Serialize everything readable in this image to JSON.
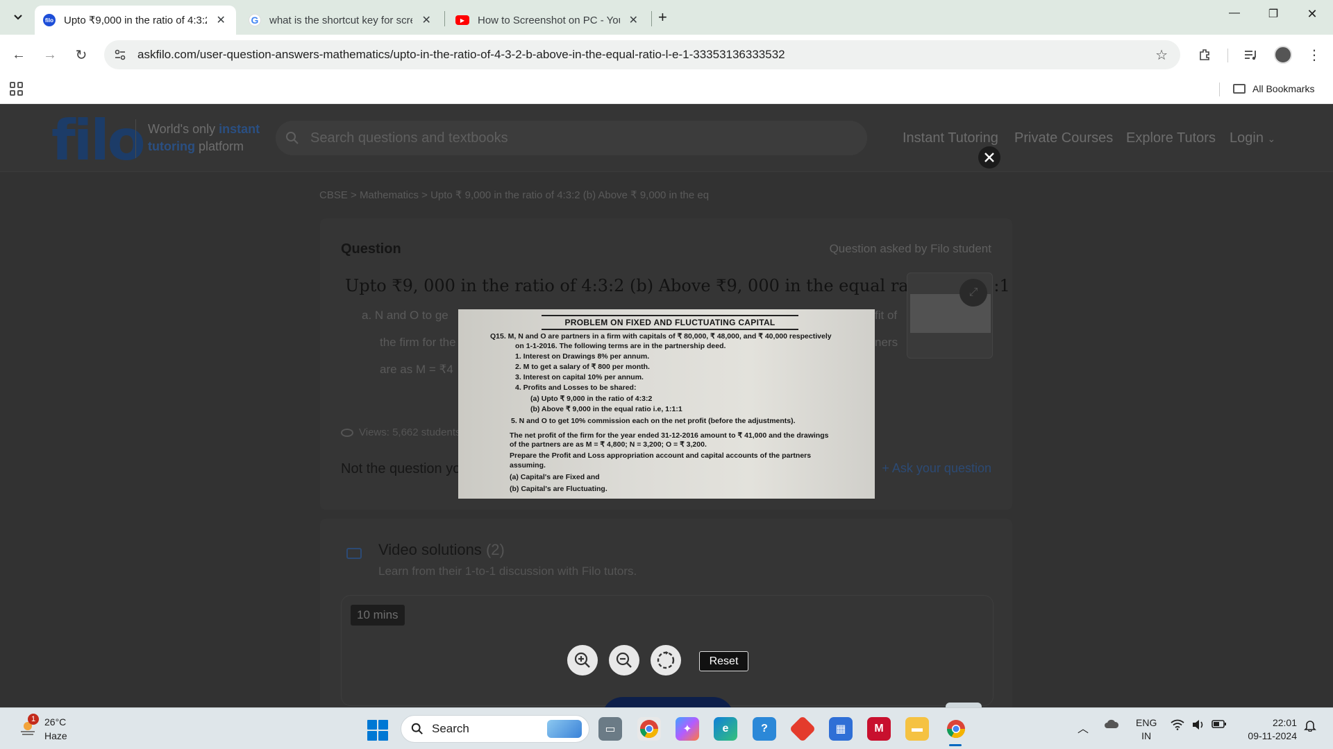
{
  "browser": {
    "tabs": [
      {
        "title": "Upto ₹9,000 in the ratio of 4:3:2",
        "favicon": "filo",
        "active": true
      },
      {
        "title": "what is the shortcut key for scre",
        "favicon": "G",
        "active": false
      },
      {
        "title": "How to Screenshot on PC - You",
        "favicon": "youtube",
        "active": false
      }
    ],
    "url": "askfilo.com/user-question-answers-mathematics/upto-in-the-ratio-of-4-3-2-b-above-in-the-equal-ratio-l-e-1-33353136333532",
    "bookmarks_label": "All Bookmarks"
  },
  "site": {
    "logo": "filo",
    "tagline_pre": "World's only ",
    "tagline_hl1": "instant",
    "tagline_hl2": "tutoring",
    "tagline_post": " platform",
    "search_placeholder": "Search questions and textbooks",
    "nav": [
      "Instant Tutoring",
      "Private Courses",
      "Explore Tutors",
      "Login"
    ]
  },
  "breadcrumb": "CBSE > Mathematics > Upto ₹ 9,000 in the ratio of 4:3:2 (b) Above ₹ 9,000 in the eq",
  "question": {
    "label": "Question",
    "asked_by": "Question asked by Filo student",
    "text": "Upto ₹9, 000 in the ratio of 4:3:2 (b) Above ₹9, 000 in the equal ratio l.e, 1:1:1",
    "line_a": "a.  N and O to ge",
    "line_a_tail": "fit of",
    "line_b": "the firm for the",
    "line_b_tail": "ners",
    "line_c": "are as M = ₹4",
    "views": "Views: 5,662 students",
    "not_question": "Not the question yo",
    "ask": "+ Ask your question"
  },
  "video": {
    "title": "Video solutions",
    "count": "(2)",
    "subtitle": "Learn from their 1-to-1 discussion with Filo tutors.",
    "duration": "10 mins"
  },
  "viewer_image": {
    "title": "PROBLEM ON FIXED AND FLUCTUATING CAPITAL",
    "lines": [
      "Q15.  M, N and O are partners in a firm with capitals of ₹ 80,000, ₹ 48,000, and ₹ 40,000 respectively",
      "on 1-1-2016. The following terms are in the partnership deed.",
      "1.     Interest on Drawings 8% per annum.",
      "2.     M to get a salary of ₹ 800 per month.",
      "3.     Interest on capital 10% per annum.",
      "4.     Profits and Losses to be shared:",
      "(a)  Upto ₹ 9,000 in the ratio of 4:3:2",
      "(b)  Above ₹ 9,000 in the equal ratio i.e, 1:1:1",
      "5.    N and O to get 10% commission each on the net profit (before the adjustments).",
      "The net profit of the firm for the year ended 31-12-2016 amount to ₹ 41,000 and the drawings",
      "of the partners are as M = ₹ 4,800; N = 3,200; O = ₹ 3,200.",
      "Prepare the Profit and Loss appropriation account and capital accounts of the partners",
      "assuming.",
      "(a)  Capital's are Fixed and",
      "(b)  Capital's are Fluctuating."
    ]
  },
  "viewer_controls": {
    "reset": "Reset"
  },
  "taskbar": {
    "weather_badge": "1",
    "temp": "26°C",
    "condition": "Haze",
    "search": "Search",
    "lang1": "ENG",
    "lang2": "IN",
    "time": "22:01",
    "date": "09-11-2024"
  }
}
